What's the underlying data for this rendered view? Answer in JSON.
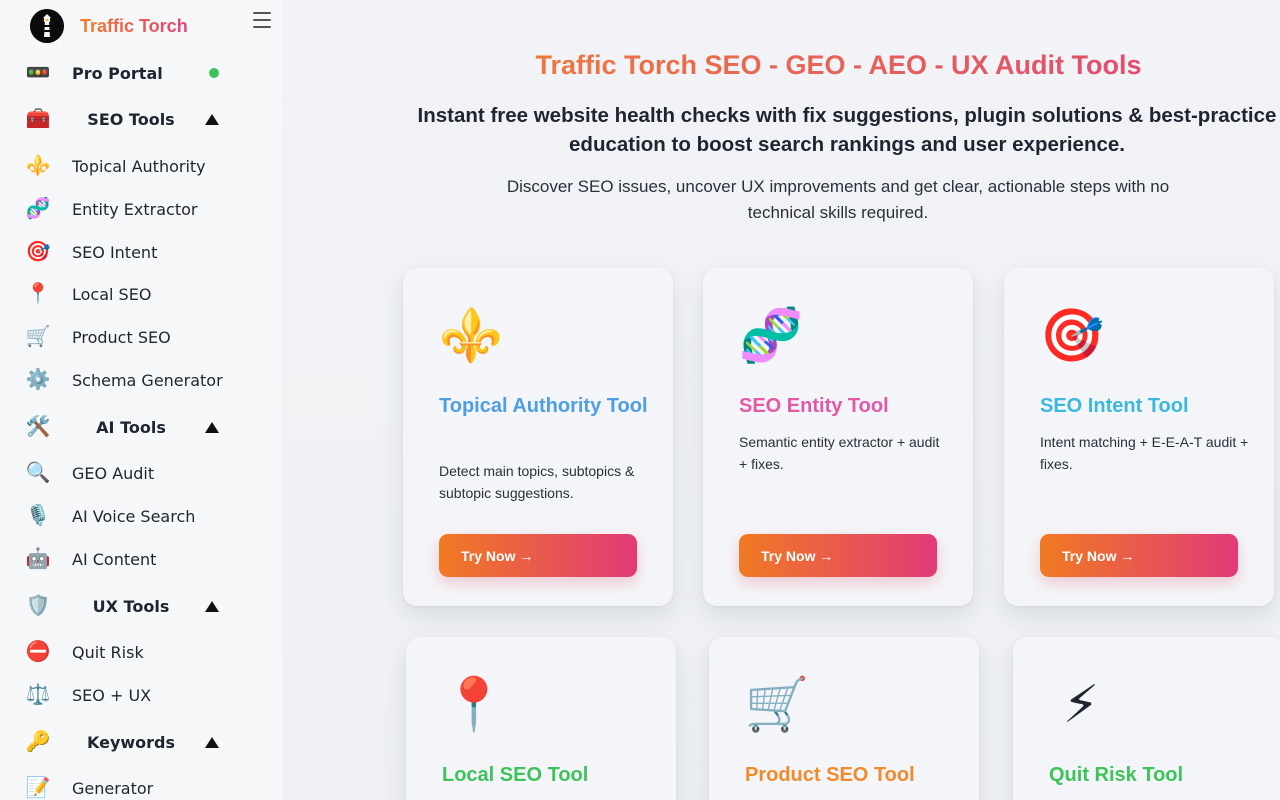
{
  "brand": {
    "name": "Traffic Torch"
  },
  "sidebar": {
    "items": [
      {
        "label": "Pro Portal",
        "icon": "traffic-light-icon",
        "glyph": "🚥",
        "type": "bold",
        "status": "online"
      },
      {
        "label": "SEO Tools",
        "icon": "toolbox-icon",
        "glyph": "🧰",
        "type": "section"
      },
      {
        "label": "Topical Authority",
        "icon": "fleur-de-lis-icon",
        "glyph": "⚜️",
        "type": "item"
      },
      {
        "label": "Entity Extractor",
        "icon": "dna-icon",
        "glyph": "🧬",
        "type": "item"
      },
      {
        "label": "SEO Intent",
        "icon": "target-icon",
        "glyph": "🎯",
        "type": "item"
      },
      {
        "label": "Local SEO",
        "icon": "pin-icon",
        "glyph": "📍",
        "type": "item"
      },
      {
        "label": "Product SEO",
        "icon": "cart-icon",
        "glyph": "🛒",
        "type": "item"
      },
      {
        "label": "Schema Generator",
        "icon": "gear-icon",
        "glyph": "⚙️",
        "type": "item"
      },
      {
        "label": "AI Tools",
        "icon": "tools-icon",
        "glyph": "🛠️",
        "type": "section"
      },
      {
        "label": "GEO Audit",
        "icon": "magnifier-icon",
        "glyph": "🔍",
        "type": "item"
      },
      {
        "label": "AI Voice Search",
        "icon": "microphone-icon",
        "glyph": "🎙️",
        "type": "item"
      },
      {
        "label": "AI Content",
        "icon": "robot-icon",
        "glyph": "🤖",
        "type": "item"
      },
      {
        "label": "UX Tools",
        "icon": "shield-icon",
        "glyph": "🛡️",
        "type": "section"
      },
      {
        "label": "Quit Risk",
        "icon": "no-entry-icon",
        "glyph": "⛔",
        "type": "item"
      },
      {
        "label": "SEO + UX",
        "icon": "scales-icon",
        "glyph": "⚖️",
        "type": "item"
      },
      {
        "label": "Keywords",
        "icon": "key-icon",
        "glyph": "🔑",
        "type": "section"
      },
      {
        "label": "Generator",
        "icon": "memo-icon",
        "glyph": "📝",
        "type": "item"
      }
    ]
  },
  "hero": {
    "title": "Traffic Torch SEO - GEO - AEO - UX Audit Tools",
    "subtitle": "Instant free website health checks with fix suggestions, plugin solutions & best-practice education to boost search rankings and user experience.",
    "description": "Discover SEO issues, uncover UX improvements and get clear, actionable steps with no technical skills required."
  },
  "cards": [
    {
      "title": "Topical Authority Tool",
      "desc": "Detect main topics, subtopics & subtopic suggestions.",
      "button": "Try Now →",
      "icon": "fleur-de-lis-icon",
      "glyph": "⚜️",
      "color": "#4e9ee6"
    },
    {
      "title": "SEO Entity Tool",
      "desc": "Semantic entity extractor + audit + fixes.",
      "button": "Try Now →",
      "icon": "dna-icon",
      "glyph": "🧬",
      "color": "#e458a8"
    },
    {
      "title": "SEO Intent Tool",
      "desc": "Intent matching + E-E-A-T audit + fixes.",
      "button": "Try Now →",
      "icon": "target-icon",
      "glyph": "🎯",
      "color": "#3bb8e0"
    },
    {
      "title": "Local SEO Tool",
      "desc": "",
      "button": "",
      "icon": "pushpin-icon",
      "glyph": "📍",
      "color": "#3ec35b"
    },
    {
      "title": "Product SEO Tool",
      "desc": "",
      "button": "",
      "icon": "shopping-cart-icon",
      "glyph": "🛒",
      "color": "#f08a2a"
    },
    {
      "title": "Quit Risk Tool",
      "desc": "",
      "button": "",
      "icon": "lightning-icon",
      "glyph": "⚡",
      "color": "#3ec35b"
    }
  ]
}
